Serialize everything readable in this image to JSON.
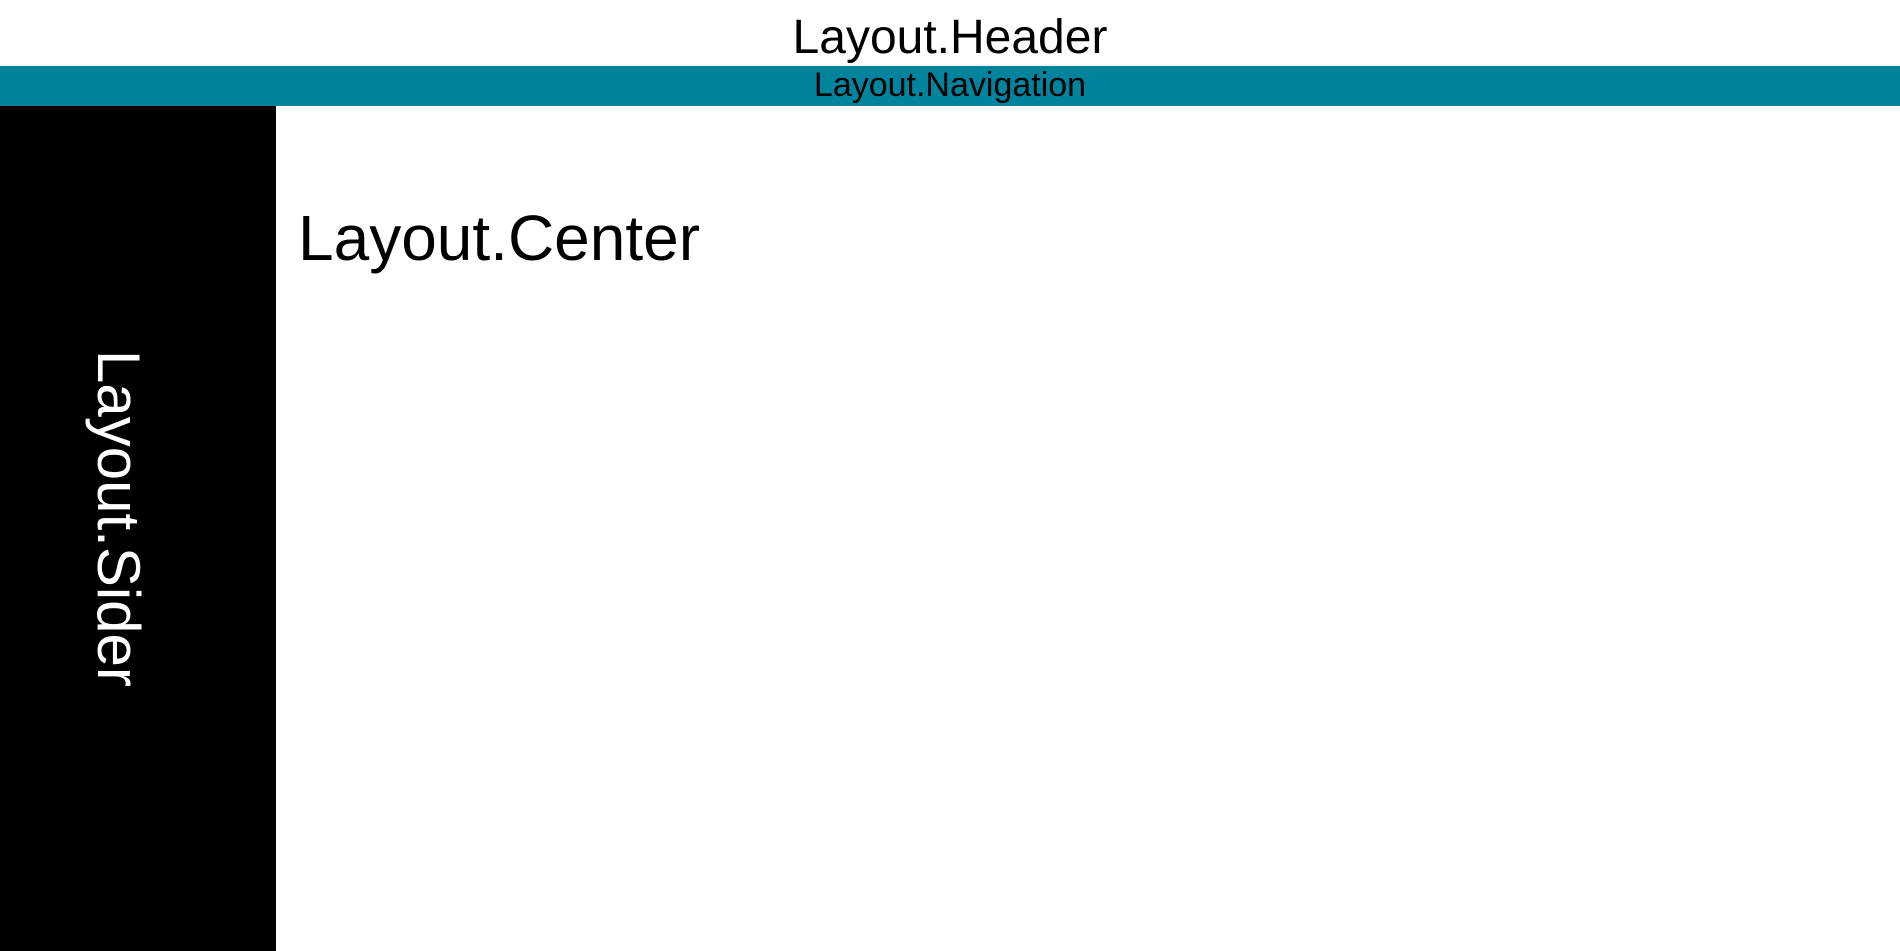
{
  "layout": {
    "header_label": "Layout.Header",
    "navigation_label": "Layout.Navigation",
    "sider_label": "Layout.Sider",
    "center_label": "Layout.Center"
  },
  "icons": {
    "sider_toggle": "chevron-right-icon"
  },
  "colors": {
    "navigation_bg": "#00839c",
    "sider_bg": "#000000",
    "header_bg": "#ffffff",
    "center_bg": "#ffffff"
  }
}
